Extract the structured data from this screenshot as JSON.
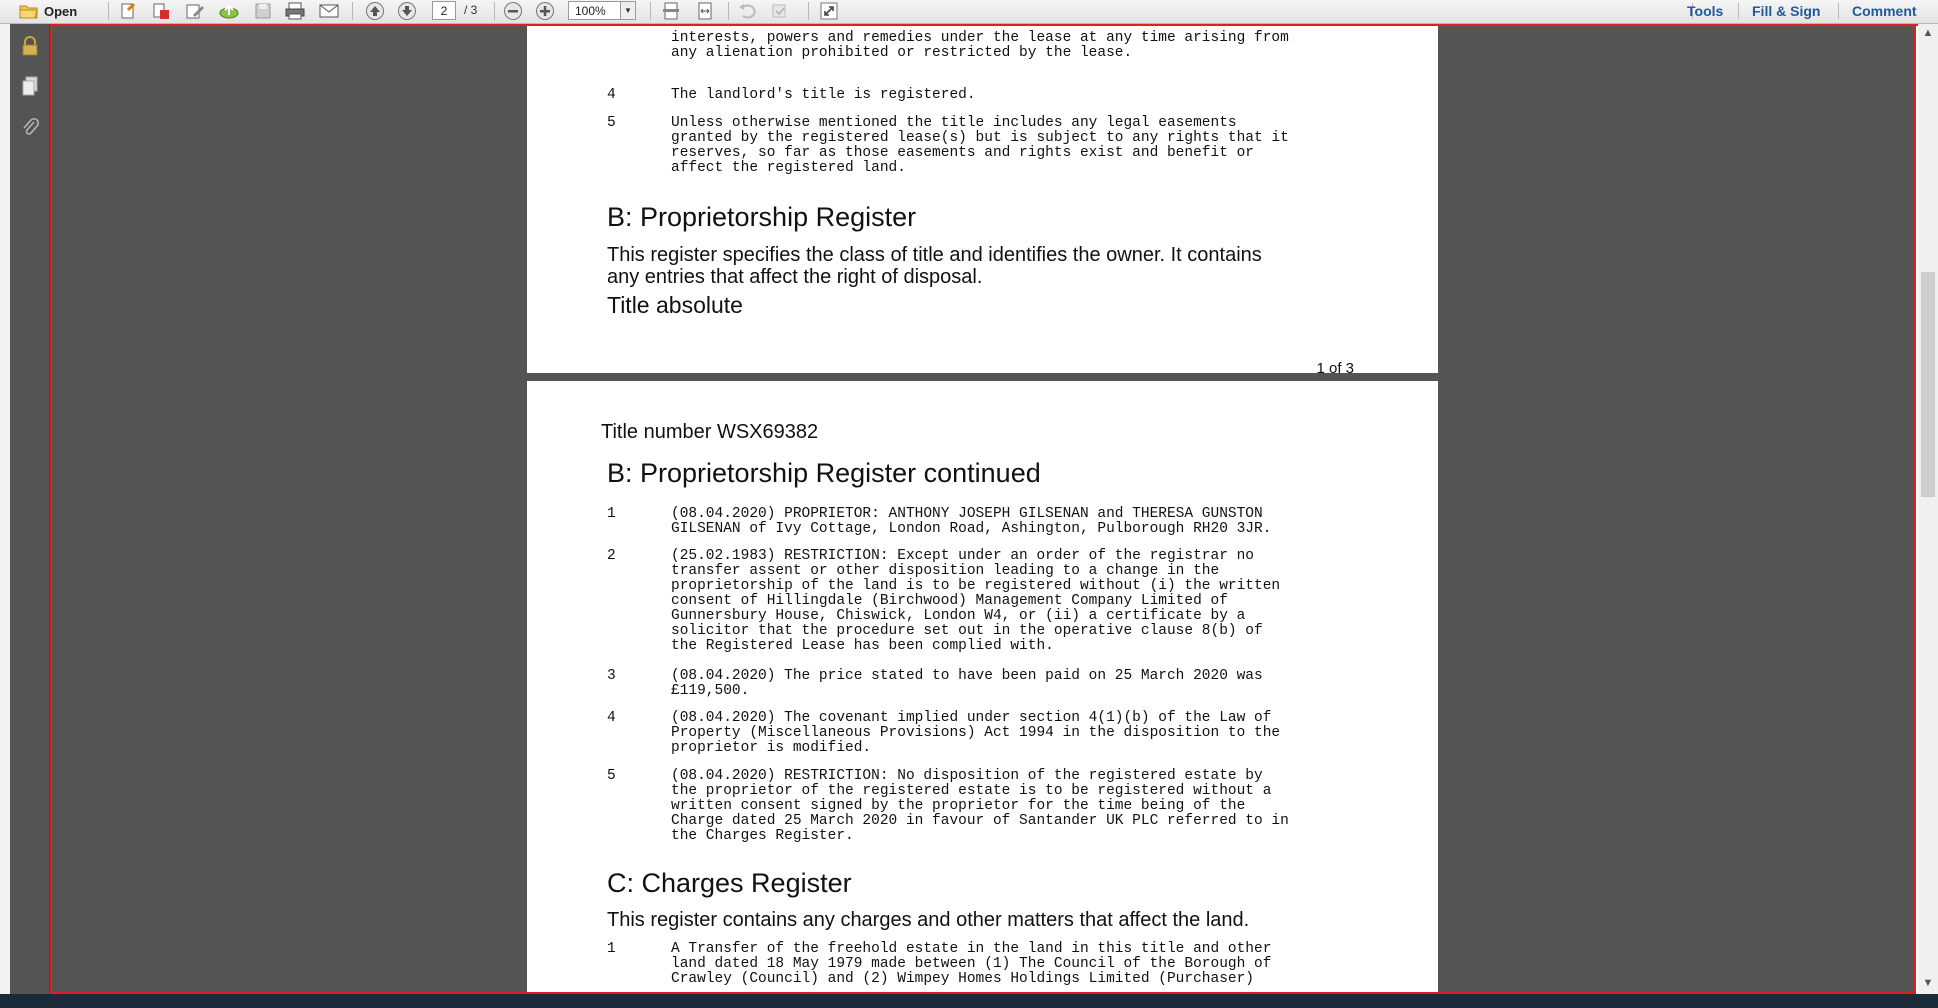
{
  "toolbar": {
    "open_label": "Open",
    "current_page": "2",
    "total_pages": "/ 3",
    "zoom": "100%",
    "icons": [
      "folder-open-icon",
      "create-pdf-icon",
      "combine-icon",
      "edit-icon",
      "upload-cloud-icon",
      "save-icon",
      "print-icon",
      "email-icon",
      "page-up-icon",
      "page-down-icon",
      "zoom-out-icon",
      "zoom-in-icon",
      "fit-page-icon",
      "fit-width-icon",
      "undo-icon",
      "redo-icon",
      "expand-icon"
    ],
    "right_links": {
      "tools": "Tools",
      "fill_sign": "Fill & Sign",
      "comment": "Comment"
    }
  },
  "nav_pane": {
    "icons": [
      "lock-icon",
      "pages-icon",
      "attachment-icon"
    ]
  },
  "page1": {
    "entry_top_partial": {
      "text": "interests, powers and remedies under the lease at any time arising from\nany alienation prohibited or restricted by the lease."
    },
    "entry4": {
      "num": "4",
      "text": "The landlord's title is registered."
    },
    "entry5": {
      "num": "5",
      "text": "Unless otherwise mentioned the title includes any legal easements\ngranted by the registered lease(s) but is subject to any rights that it\nreserves, so far as those easements and rights exist and benefit or\naffect the registered land."
    },
    "section_b_title": "B: Proprietorship Register",
    "section_b_desc": "This register specifies the class of title and identifies the owner. It contains\nany entries that affect the right of disposal.",
    "title_class": "Title absolute",
    "footer": "1 of 3"
  },
  "page2": {
    "title_number": "Title number WSX69382",
    "section_b_cont": "B: Proprietorship Register continued",
    "entries": [
      {
        "num": "1",
        "text": "(08.04.2020) PROPRIETOR: ANTHONY JOSEPH GILSENAN and THERESA GUNSTON\nGILSENAN of Ivy Cottage, London Road, Ashington, Pulborough RH20 3JR."
      },
      {
        "num": "2",
        "text": "(25.02.1983) RESTRICTION: Except under an order of the registrar no\ntransfer assent or other disposition leading to a change in the\nproprietorship of the land is to be registered without (i) the written\nconsent of Hillingdale (Birchwood) Management Company Limited of\nGunnersbury House, Chiswick, London W4, or (ii) a certificate by a\nsolicitor that the procedure set out in the operative clause 8(b) of\nthe Registered Lease has been complied with."
      },
      {
        "num": "3",
        "text": "(08.04.2020) The price stated to have been paid on 25 March 2020 was\n£119,500."
      },
      {
        "num": "4",
        "text": "(08.04.2020) The covenant implied under section 4(1)(b) of the Law of\nProperty (Miscellaneous Provisions) Act 1994 in the disposition to the\nproprietor is modified."
      },
      {
        "num": "5",
        "text": "(08.04.2020) RESTRICTION: No disposition of the registered estate by\nthe proprietor of the registered estate is to be registered without a\nwritten consent signed by the proprietor for the time being of the\nCharge dated 25 March 2020 in favour of Santander UK PLC referred to in\nthe Charges Register."
      }
    ],
    "section_c_title": "C: Charges Register",
    "section_c_desc": "This register contains any charges and other matters that affect the land.",
    "c_entry1": {
      "num": "1",
      "text": "A Transfer of the freehold estate in the land in this title and other\nland dated 18 May 1979 made between (1) The Council of the Borough of\nCrawley (Council) and (2) Wimpey Homes Holdings Limited (Purchaser)"
    }
  },
  "scrollbar": {
    "up_icon": "scroll-up-icon",
    "down_icon": "scroll-down-icon"
  }
}
